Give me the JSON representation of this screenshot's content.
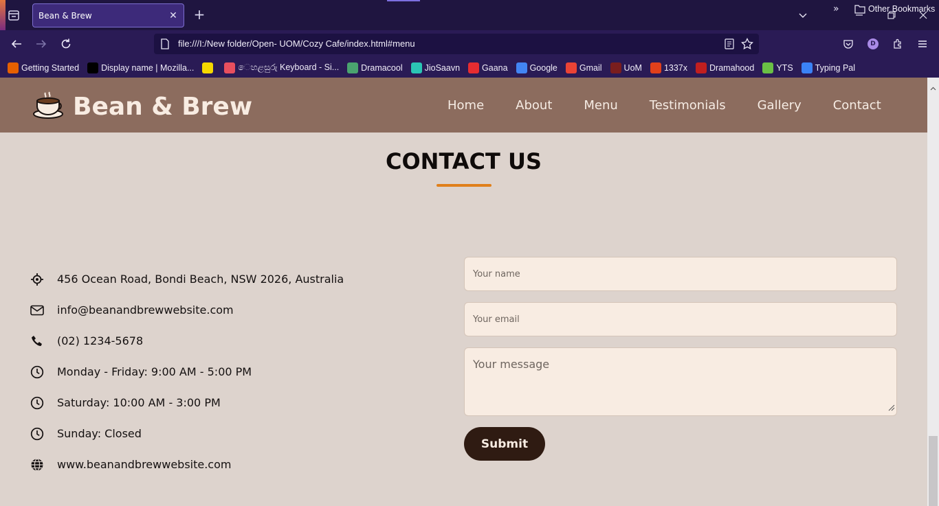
{
  "browser": {
    "tab_title": "Bean & Brew",
    "url": "file:///I:/New folder/Open- UOM/Cozy Cafe/index.html#menu",
    "profile_initial": "D",
    "bookmarks": [
      {
        "label": "Getting Started",
        "icon": "firefox-icon",
        "color": "#e66000"
      },
      {
        "label": "Display name | Mozilla...",
        "icon": "mozilla-m-icon",
        "color": "#000000"
      },
      {
        "label": "",
        "icon": "w-icon",
        "color": "#f5d800"
      },
      {
        "label": "ෙහළසුරු Keyboard - Si...",
        "icon": "flower-icon",
        "color": "#e84f5e"
      },
      {
        "label": "Dramacool",
        "icon": "dramacool-icon",
        "color": "#4aa36f"
      },
      {
        "label": "JioSaavn",
        "icon": "jiosaavn-icon",
        "color": "#2bc5b4"
      },
      {
        "label": "Gaana",
        "icon": "gaana-icon",
        "color": "#e72c30"
      },
      {
        "label": "Google",
        "icon": "google-icon",
        "color": "#4285f4"
      },
      {
        "label": "Gmail",
        "icon": "gmail-icon",
        "color": "#ea4335"
      },
      {
        "label": "UoM",
        "icon": "uom-icon",
        "color": "#7a1e1e"
      },
      {
        "label": "1337x",
        "icon": "1337x-icon",
        "color": "#e1401b"
      },
      {
        "label": "Dramahood",
        "icon": "dramahood-icon",
        "color": "#c11f1f"
      },
      {
        "label": "YTS",
        "icon": "yts-icon",
        "color": "#6ac045"
      },
      {
        "label": "Typing Pal",
        "icon": "typingpal-icon",
        "color": "#3b82f6"
      }
    ],
    "other_bookmarks": "Other Bookmarks"
  },
  "site": {
    "brand": "Bean & Brew",
    "nav": [
      "Home",
      "About",
      "Menu",
      "Testimonials",
      "Gallery",
      "Contact"
    ]
  },
  "contact": {
    "title": "CONTACT US",
    "info": [
      {
        "icon": "location-icon",
        "text": "456 Ocean Road, Bondi Beach, NSW 2026, Australia"
      },
      {
        "icon": "envelope-icon",
        "text": "info@beanandbrewwebsite.com"
      },
      {
        "icon": "phone-icon",
        "text": "(02) 1234-5678"
      },
      {
        "icon": "clock-icon",
        "text": "Monday - Friday: 9:00 AM - 5:00 PM"
      },
      {
        "icon": "clock-icon",
        "text": "Saturday: 10:00 AM - 3:00 PM"
      },
      {
        "icon": "clock-icon",
        "text": "Sunday: Closed"
      },
      {
        "icon": "globe-icon",
        "text": "www.beanandbrewwebsite.com"
      }
    ],
    "form": {
      "name_placeholder": "Your name",
      "email_placeholder": "Your email",
      "message_placeholder": "Your message",
      "submit_label": "Submit"
    }
  },
  "colors": {
    "header_bg": "#8c6c5e",
    "page_bg": "#ddd3cd",
    "accent": "#e07f1a",
    "button_bg": "#2f1b12",
    "field_bg": "#f8ece2"
  }
}
